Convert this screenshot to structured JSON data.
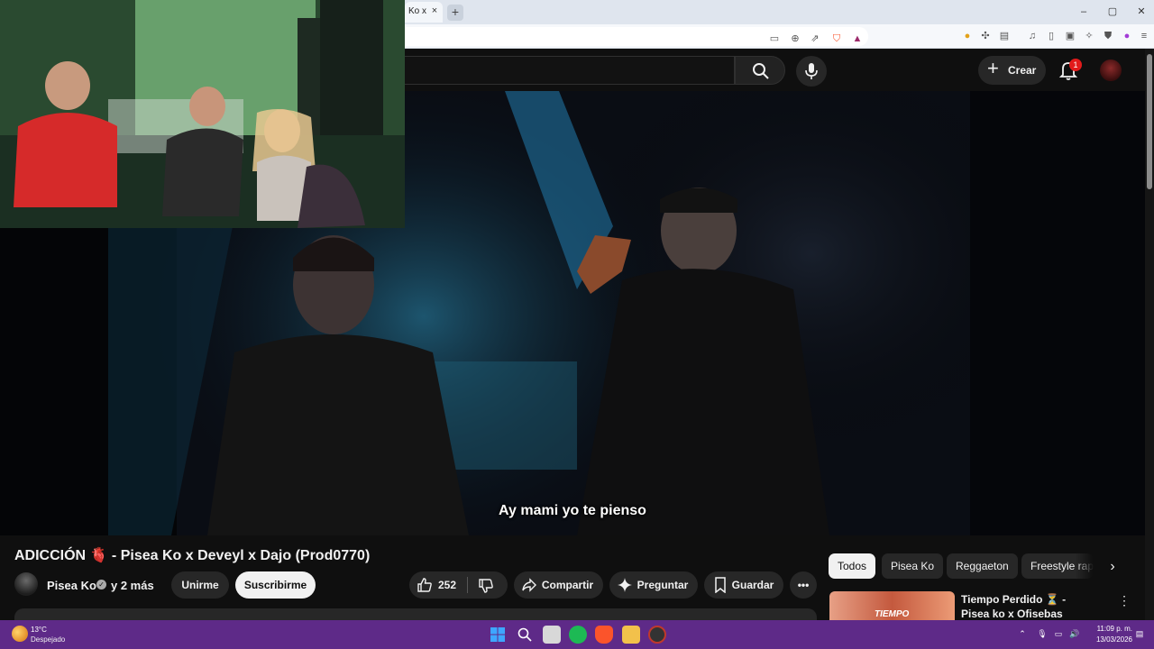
{
  "browser": {
    "tab_title": "Ko x",
    "tab_close": "×",
    "new_tab": "+",
    "window_controls": {
      "minimize": "‒",
      "maximize": "▢",
      "close": "✕"
    }
  },
  "youtube": {
    "create_label": "Crear",
    "create_plus": "+",
    "notification_count": "1",
    "video": {
      "subtitle": "Ay mami yo te pienso",
      "title": "ADICCIÓN 🫀 - Pisea Ko x Deveyl x Dajo (Prod0770)",
      "channel_name": "Pisea Ko",
      "verified": "✓",
      "channel_more": "y 2 más",
      "join_label": "Unirme",
      "subscribe_label": "Suscribirme",
      "like_count": "252",
      "share_label": "Compartir",
      "ask_label": "Preguntar",
      "save_label": "Guardar",
      "more_label": "•••"
    },
    "chips": [
      "Todos",
      "Pisea Ko",
      "Reggaeton",
      "Freestyle rap"
    ],
    "chip_next": "›",
    "recommendation": {
      "title": "Tiempo Perdido ⏳ - Pisea ko x Ofisebas",
      "thumb_text": "TIEMPO",
      "menu": "⋮"
    }
  },
  "taskbar": {
    "weather_temp": "13°C",
    "weather_desc": "Despejado",
    "time": "11:09 p. m.",
    "date": "13/03/2026",
    "tray_arrow": "⌃",
    "colors": {
      "background": "#5e2a88",
      "accent": "#3ea6ff"
    }
  },
  "colors": {
    "youtube_bg": "#0f0f0f",
    "subscribe_bg": "#f1f1f1",
    "badge": "#e21b1b"
  }
}
